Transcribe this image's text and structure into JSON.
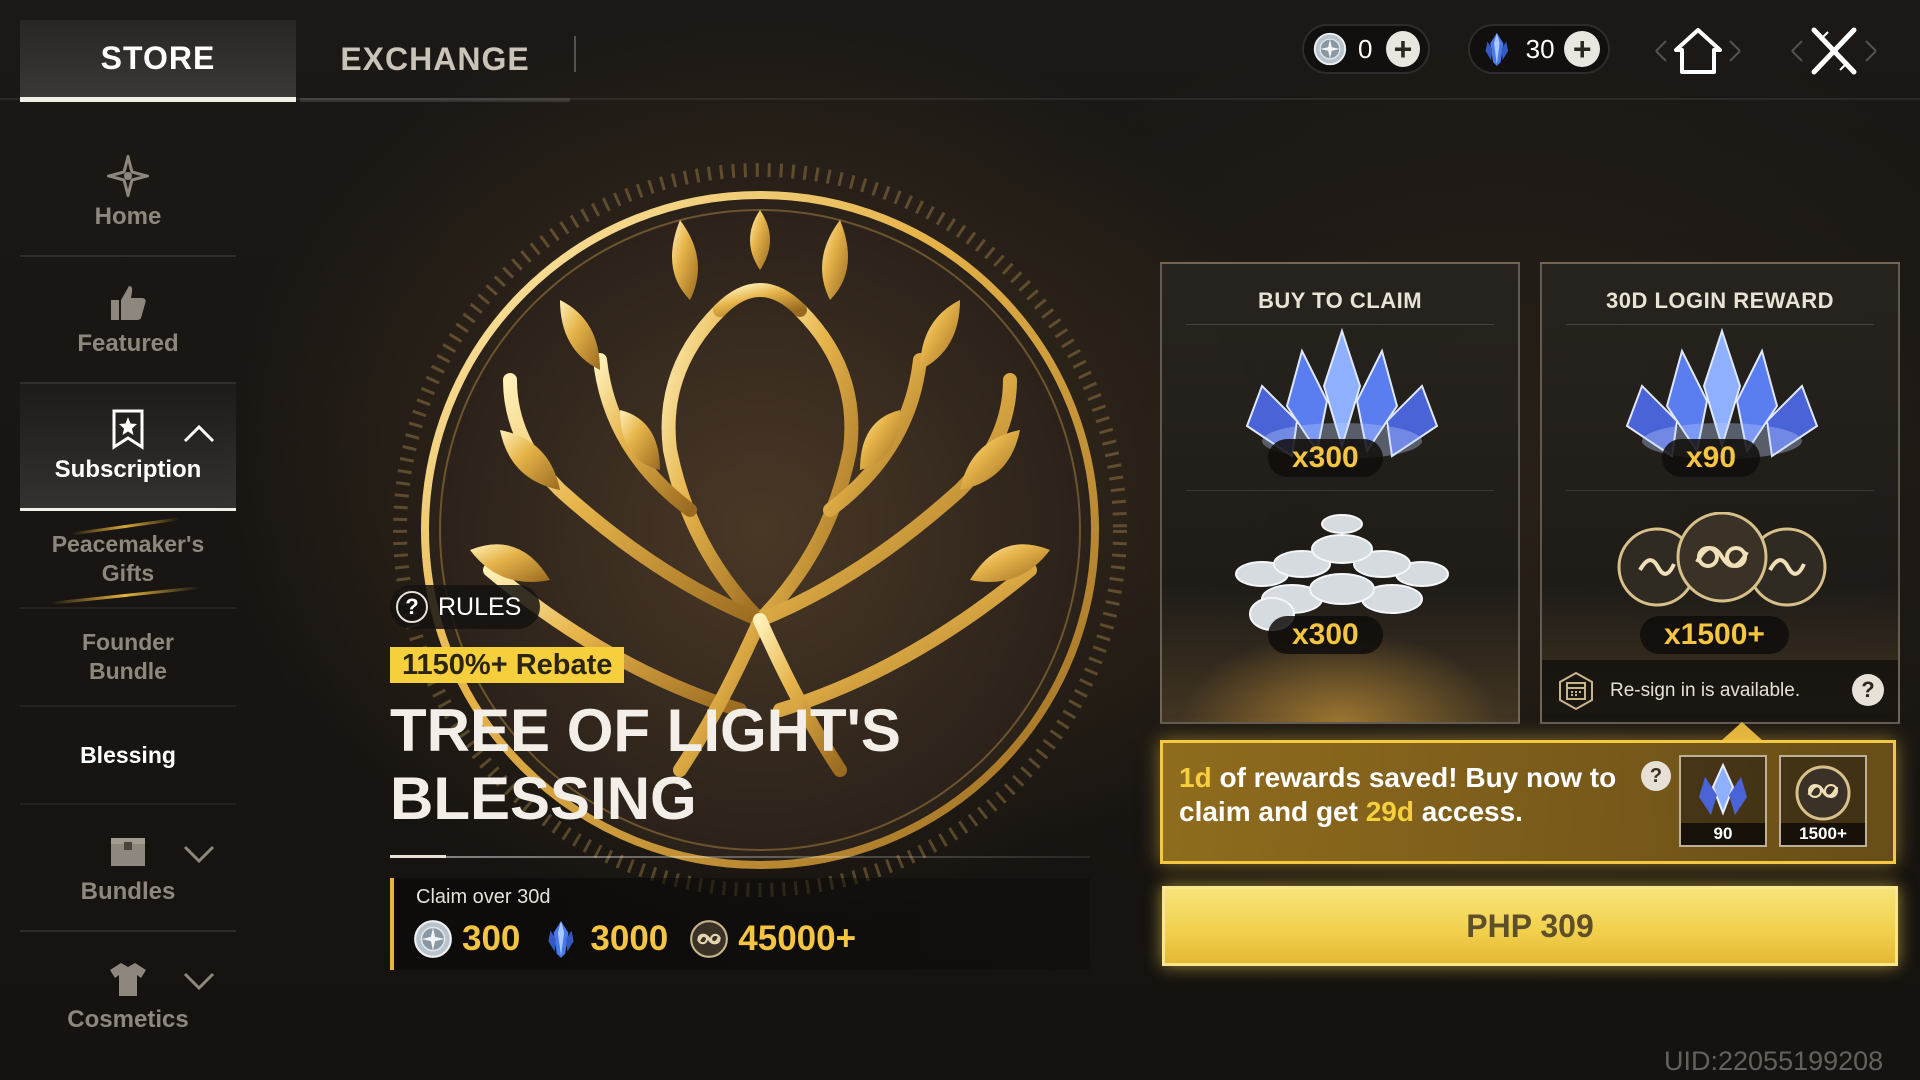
{
  "tabs": [
    {
      "label": "STORE",
      "active": true
    },
    {
      "label": "EXCHANGE",
      "active": false
    }
  ],
  "currencies": [
    {
      "icon": "silver-coin-icon",
      "value": "0"
    },
    {
      "icon": "crystal-icon",
      "value": "30"
    }
  ],
  "sidebar": {
    "items": [
      {
        "label": "Home",
        "icon": "home-star-icon"
      },
      {
        "label": "Featured",
        "icon": "thumbs-up-icon"
      },
      {
        "label": "Subscription",
        "icon": "bookmark-star-icon",
        "expanded": true
      },
      {
        "label": "Peacemaker's Gifts"
      },
      {
        "label": "Founder Bundle"
      },
      {
        "label": "Blessing",
        "selected": true
      },
      {
        "label": "Bundles",
        "icon": "box-icon"
      },
      {
        "label": "Cosmetics",
        "icon": "shirt-icon"
      }
    ]
  },
  "hero": {
    "rules_label": "RULES",
    "rebate": "1150%+ Rebate",
    "title": "TREE OF LIGHT'S BLESSING",
    "claim_label": "Claim over 30d",
    "claim_values": [
      "300",
      "3000",
      "45000+"
    ]
  },
  "cards": [
    {
      "title": "BUY TO CLAIM",
      "items": [
        {
          "icon": "crystal-cluster-icon",
          "qty": "x300"
        },
        {
          "icon": "silver-coins-pile-icon",
          "qty": "x300"
        }
      ]
    },
    {
      "title": "30D LOGIN REWARD",
      "items": [
        {
          "icon": "crystal-cluster-icon",
          "qty": "x90"
        },
        {
          "icon": "gold-tokens-icon",
          "qty": "x1500+"
        }
      ],
      "note": "Re-sign in is available."
    }
  ],
  "saved_banner": {
    "days_saved": "1d",
    "text_a": " of rewards saved! Buy now to claim and get ",
    "days_access": "29d",
    "text_b": " access.",
    "mini_items": [
      "90",
      "1500+"
    ]
  },
  "buy_button": "PHP 309",
  "uid": "UID:22055199208",
  "colors": {
    "accent_gold": "#f4c542",
    "rebate_bg": "#f6cf3c",
    "button_gold": "#f1cf4a"
  }
}
